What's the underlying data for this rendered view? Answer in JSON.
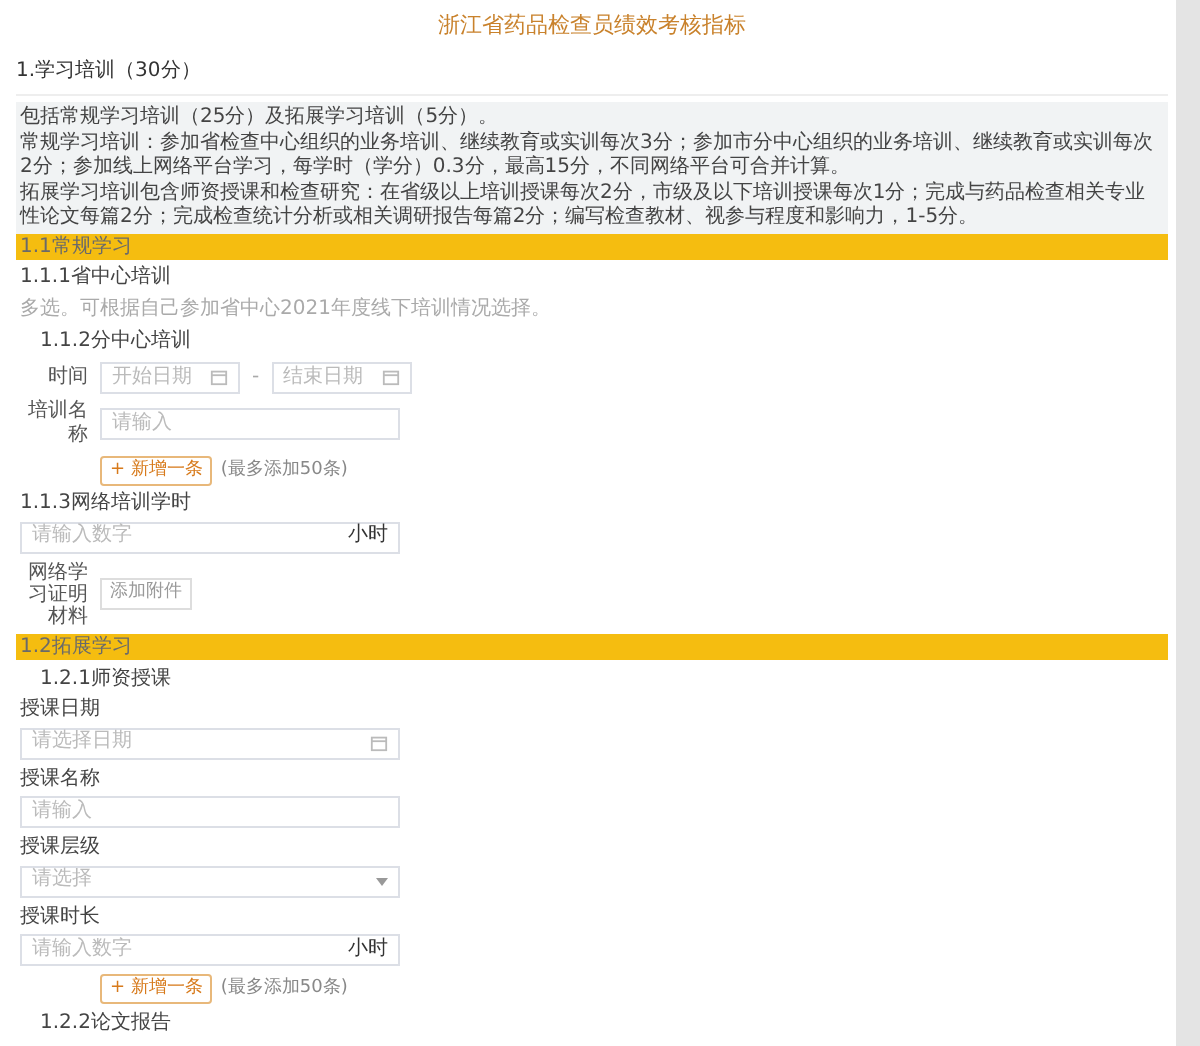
{
  "title": "浙江省药品检查员绩效考核指标",
  "section": {
    "heading": "1.学习培训（30分）",
    "notes": [
      "包括常规学习培训（25分）及拓展学习培训（5分）。",
      "常规学习培训：参加省检查中心组织的业务培训、继续教育或实训每次3分；参加市分中心组织的业务培训、继续教育或实训每次2分；参加线上网络平台学习，每学时（学分）0.3分，最高15分，不同网络平台可合并计算。",
      "拓展学习培训包含师资授课和检查研究：在省级以上培训授课每次2分，市级及以下培训授课每次1分；完成与药品检查相关专业性论文每篇2分；完成检查统计分析或相关调研报告每篇2分；编写检查教材、视参与程度和影响力，1-5分。"
    ]
  },
  "rows": [
    {
      "kind": "band",
      "text": "1.1常规学习"
    },
    {
      "kind": "caption",
      "text": "1.1.1省中心培训"
    },
    {
      "kind": "hint",
      "text": "多选。可根据自己参加省中心2021年度线下培训情况选择。"
    },
    {
      "kind": "sub",
      "text": "1.1.2分中心培训"
    },
    {
      "kind": "range",
      "label": "时间",
      "start": "开始日期",
      "separator": "-",
      "end": "结束日期"
    },
    {
      "kind": "inline-field",
      "label": "培训名称",
      "placeholder": "请输入"
    },
    {
      "kind": "add",
      "button": "+ 新增一条",
      "note": "(最多添加50条)"
    },
    {
      "kind": "caption",
      "text": "1.1.3网络培训学时"
    },
    {
      "kind": "number-field",
      "placeholder": "请输入数字",
      "suffix": "小时"
    },
    {
      "kind": "attach",
      "label": "网络学习证明材料",
      "button": "添加附件"
    },
    {
      "kind": "band",
      "text": "1.2拓展学习"
    },
    {
      "kind": "sub",
      "text": "1.2.1师资授课"
    },
    {
      "kind": "caption",
      "text": "授课日期"
    },
    {
      "kind": "date-field",
      "placeholder": "请选择日期"
    },
    {
      "kind": "caption",
      "text": "授课名称"
    },
    {
      "kind": "text-field",
      "placeholder": "请输入"
    },
    {
      "kind": "caption",
      "text": "授课层级"
    },
    {
      "kind": "select-field",
      "placeholder": "请选择"
    },
    {
      "kind": "caption",
      "text": "授课时长"
    },
    {
      "kind": "number-field",
      "placeholder": "请输入数字",
      "suffix": "小时"
    },
    {
      "kind": "add",
      "button": "+ 新增一条",
      "note": "(最多添加50条)"
    },
    {
      "kind": "sub",
      "text": "1.2.2论文报告"
    }
  ]
}
